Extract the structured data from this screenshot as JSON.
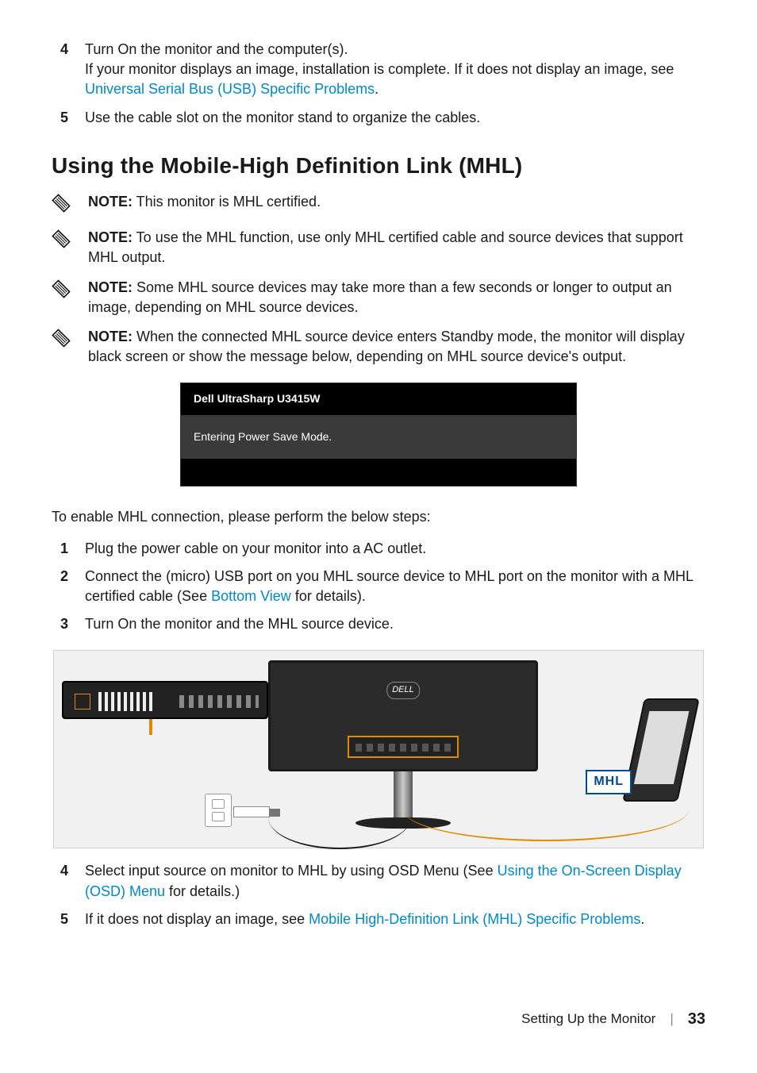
{
  "top_list": [
    {
      "n": "4",
      "line1": "Turn On the monitor and the computer(s).",
      "line2_a": "If your monitor displays an image, installation is complete. If it does not display an image, see ",
      "line2_link": "Universal Serial Bus (USB) Specific Problems",
      "line2_b": "."
    },
    {
      "n": "5",
      "line1": "Use the cable slot on the monitor stand to organize the cables."
    }
  ],
  "section_heading": "Using the Mobile-High Definition Link (MHL)",
  "notes": [
    {
      "label": "NOTE:",
      "text": " This monitor is MHL certified."
    },
    {
      "label": "NOTE:",
      "text": " To use the MHL function, use only MHL certified cable and source devices that support MHL output."
    },
    {
      "label": "NOTE:",
      "text": " Some MHL source devices may take more than a few seconds or longer to output an image, depending on MHL source devices."
    },
    {
      "label": "NOTE:",
      "text": " When the connected MHL source device enters Standby mode, the monitor will display black screen or show the message below, depending on MHL source device's output."
    }
  ],
  "osd": {
    "title": "Dell UltraSharp U3415W",
    "message": "Entering Power Save Mode."
  },
  "enable_intro": "To enable MHL connection, please perform the below steps:",
  "steps": [
    {
      "n": "1",
      "a": "Plug the power cable on your monitor into a AC outlet."
    },
    {
      "n": "2",
      "a": "Connect the (micro) USB port on you MHL source device to MHL port on the monitor with a MHL certified cable (See ",
      "link": "Bottom View",
      "b": " for details)."
    },
    {
      "n": "3",
      "a": "Turn On the monitor and the MHL source device."
    }
  ],
  "diagram": {
    "logo": "DELL",
    "mhl_label": "MHL"
  },
  "steps_after": [
    {
      "n": "4",
      "a": "Select input source on monitor to MHL by using OSD Menu (See ",
      "link": "Using the On-Screen Display (OSD) Menu",
      "b": " for details.)"
    },
    {
      "n": "5",
      "a": "If it does not display an image, see ",
      "link": "Mobile High-Definition Link (MHL) Specific Problems",
      "b": "."
    }
  ],
  "footer": {
    "section": "Setting Up the Monitor",
    "page": "33"
  }
}
